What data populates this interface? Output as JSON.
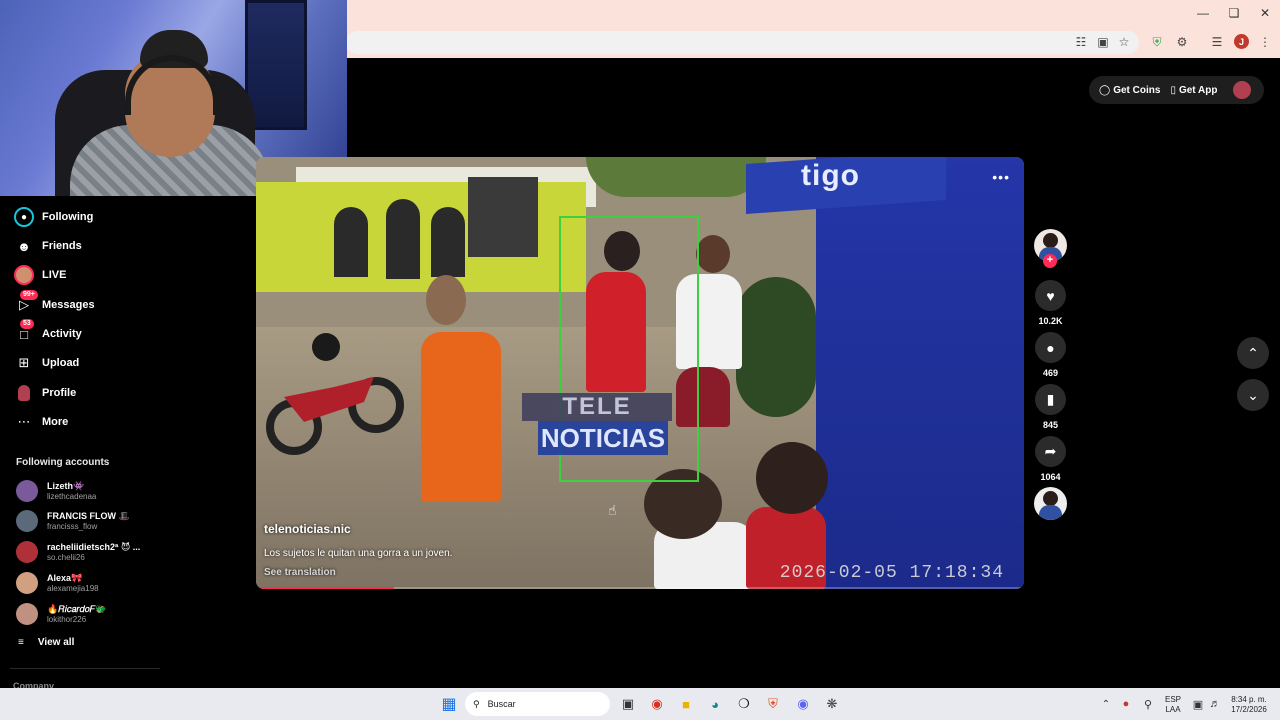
{
  "topbar": {
    "get_coins": "Get Coins",
    "get_app": "Get App"
  },
  "nav": [
    {
      "label": "Following"
    },
    {
      "label": "Friends"
    },
    {
      "label": "LIVE"
    },
    {
      "label": "Messages",
      "badge": "99+"
    },
    {
      "label": "Activity",
      "badge": "53"
    },
    {
      "label": "Upload"
    },
    {
      "label": "Profile"
    },
    {
      "label": "More"
    }
  ],
  "following_accounts": {
    "title": "Following accounts",
    "items": [
      {
        "name": "Lizeth👾",
        "handle": "lizethcadenaa",
        "color": "#7a5a9a"
      },
      {
        "name": "FRANCIS FLOW 🎩",
        "handle": "francisss_flow",
        "color": "#5a6a7a"
      },
      {
        "name": "racheliidietsch2ª 😈 ...",
        "handle": "so.chelii26",
        "color": "#b0303a"
      },
      {
        "name": "Alexa🎀",
        "handle": "alexamejia198",
        "color": "#d0a080"
      },
      {
        "name": "🔥𝑅𝑖𝑐𝑎𝑟𝑑𝑜𝐹🐲",
        "handle": "lokithor226",
        "color": "#c09080"
      }
    ],
    "view_all": "View all",
    "company": "Company"
  },
  "video": {
    "author": "telenoticias.nic",
    "caption": "Los sujetos le quitan una gorra a un joven.",
    "see_translation": "See translation",
    "overlay_sign": "tigo",
    "overlay_logo_top": "TELE",
    "overlay_logo_bottom": "NOTICIAS",
    "timestamp": "2026-02-05 17:18:34",
    "progress": 0.18
  },
  "actions": {
    "likes": "10.2K",
    "comments": "469",
    "saves": "845",
    "shares": "1064"
  },
  "taskbar": {
    "search_placeholder": "Buscar",
    "lang_top": "ESP",
    "lang_bottom": "LAA",
    "time": "8:34 p. m.",
    "date": "17/2/2026"
  },
  "colors": {
    "accent": "#fe2c55",
    "detection_box": "#3ed13e"
  }
}
